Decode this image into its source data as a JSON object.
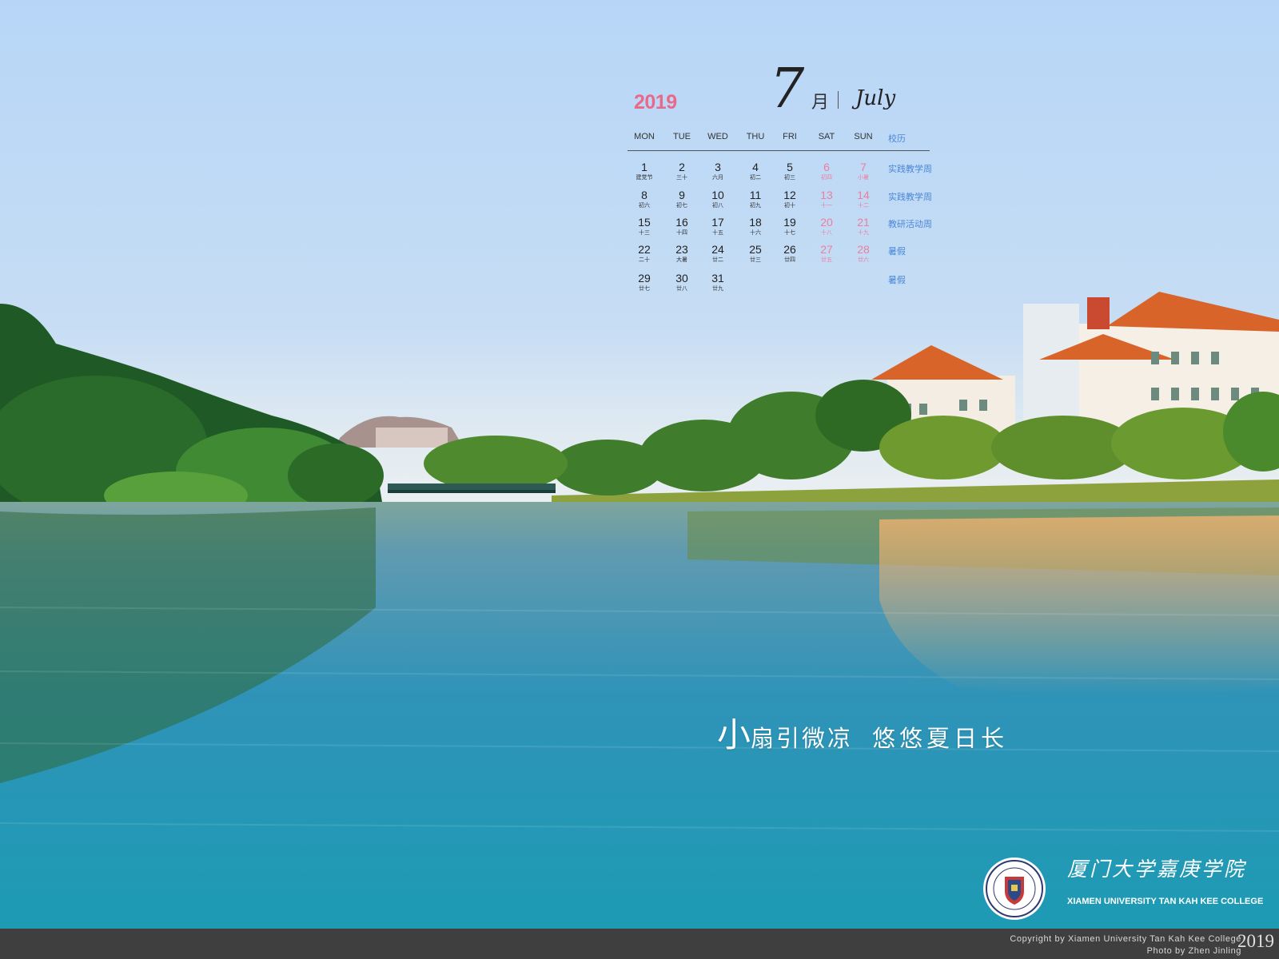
{
  "calendar": {
    "year": "2019",
    "month_number": "7",
    "month_cn": "月",
    "month_en": "July",
    "weekdays": [
      "MON",
      "TUE",
      "WED",
      "THU",
      "FRI",
      "SAT",
      "SUN"
    ],
    "school_calendar_label": "校历",
    "weeks": [
      {
        "note": "实践教学周",
        "days": [
          {
            "d": "1",
            "l": "建党节"
          },
          {
            "d": "2",
            "l": "三十"
          },
          {
            "d": "3",
            "l": "六月"
          },
          {
            "d": "4",
            "l": "初二"
          },
          {
            "d": "5",
            "l": "初三"
          },
          {
            "d": "6",
            "l": "初四"
          },
          {
            "d": "7",
            "l": "小暑"
          }
        ]
      },
      {
        "note": "实践教学周",
        "days": [
          {
            "d": "8",
            "l": "初六"
          },
          {
            "d": "9",
            "l": "初七"
          },
          {
            "d": "10",
            "l": "初八"
          },
          {
            "d": "11",
            "l": "初九"
          },
          {
            "d": "12",
            "l": "初十"
          },
          {
            "d": "13",
            "l": "十一"
          },
          {
            "d": "14",
            "l": "十二"
          }
        ]
      },
      {
        "note": "教研活动周",
        "days": [
          {
            "d": "15",
            "l": "十三"
          },
          {
            "d": "16",
            "l": "十四"
          },
          {
            "d": "17",
            "l": "十五"
          },
          {
            "d": "18",
            "l": "十六"
          },
          {
            "d": "19",
            "l": "十七"
          },
          {
            "d": "20",
            "l": "十八"
          },
          {
            "d": "21",
            "l": "十九"
          }
        ]
      },
      {
        "note": "暑假",
        "days": [
          {
            "d": "22",
            "l": "二十"
          },
          {
            "d": "23",
            "l": "大暑"
          },
          {
            "d": "24",
            "l": "廿二"
          },
          {
            "d": "25",
            "l": "廿三"
          },
          {
            "d": "26",
            "l": "廿四"
          },
          {
            "d": "27",
            "l": "廿五"
          },
          {
            "d": "28",
            "l": "廿六"
          }
        ]
      },
      {
        "note": "暑假",
        "days": [
          {
            "d": "29",
            "l": "廿七"
          },
          {
            "d": "30",
            "l": "廿八"
          },
          {
            "d": "31",
            "l": "廿九"
          }
        ]
      }
    ]
  },
  "slogan": {
    "lead_char": "小",
    "part1": "扇引微凉",
    "part2": "悠悠夏日长"
  },
  "college": {
    "name_cn": "厦门大学嘉庚学院",
    "name_en": "XIAMEN UNIVERSITY TAN KAH KEE COLLEGE"
  },
  "footer": {
    "copyright": "Copyright by Xiamen University Tan Kah Kee College",
    "photo_credit": "Photo by Zhen Jinling",
    "year": "2019"
  },
  "colors": {
    "year_accent": "#e86a8a",
    "weekend": "#ee7da0",
    "note": "#4a87d9"
  }
}
